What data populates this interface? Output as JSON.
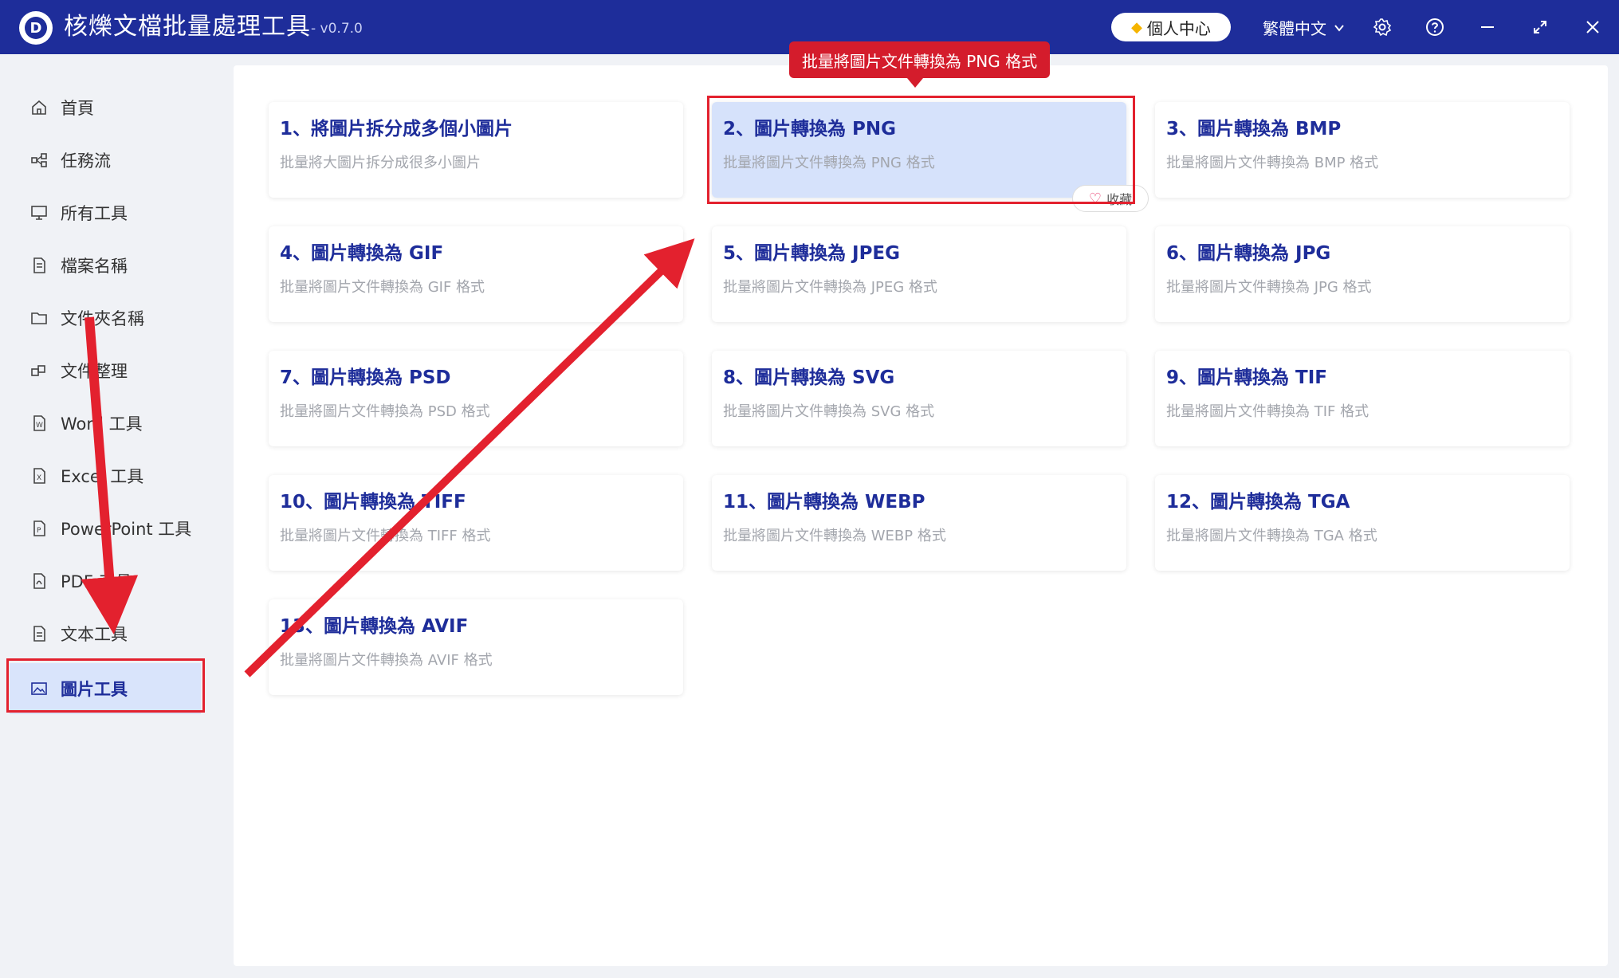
{
  "app": {
    "title": "核爍文檔批量處理工具",
    "version": "- v0.7.0",
    "logo_letter": "D",
    "user_center": "個人中心",
    "language": "繁體中文"
  },
  "sidebar": {
    "items": [
      {
        "label": "首頁",
        "icon": "home-icon"
      },
      {
        "label": "任務流",
        "icon": "workflow-icon"
      },
      {
        "label": "所有工具",
        "icon": "monitor-icon"
      },
      {
        "label": "檔案名稱",
        "icon": "file-icon"
      },
      {
        "label": "文件夾名稱",
        "icon": "folder-icon"
      },
      {
        "label": "文件整理",
        "icon": "organize-icon"
      },
      {
        "label": "Word 工具",
        "icon": "word-icon"
      },
      {
        "label": "Excel 工具",
        "icon": "excel-icon"
      },
      {
        "label": "PowerPoint 工具",
        "icon": "ppt-icon"
      },
      {
        "label": "PDF 工具",
        "icon": "pdf-icon"
      },
      {
        "label": "文本工具",
        "icon": "text-icon"
      },
      {
        "label": "圖片工具",
        "icon": "image-icon",
        "active": true
      }
    ]
  },
  "tools": [
    {
      "title": "1、將圖片拆分成多個小圖片",
      "desc": "批量將大圖片拆分成很多小圖片"
    },
    {
      "title": "2、圖片轉換為 PNG",
      "desc": "批量將圖片文件轉換為 PNG 格式",
      "active": true
    },
    {
      "title": "3、圖片轉換為 BMP",
      "desc": "批量將圖片文件轉換為 BMP 格式"
    },
    {
      "title": "4、圖片轉換為 GIF",
      "desc": "批量將圖片文件轉換為 GIF 格式"
    },
    {
      "title": "5、圖片轉換為 JPEG",
      "desc": "批量將圖片文件轉換為 JPEG 格式"
    },
    {
      "title": "6、圖片轉換為 JPG",
      "desc": "批量將圖片文件轉換為 JPG 格式"
    },
    {
      "title": "7、圖片轉換為 PSD",
      "desc": "批量將圖片文件轉換為 PSD 格式"
    },
    {
      "title": "8、圖片轉換為 SVG",
      "desc": "批量將圖片文件轉換為 SVG 格式"
    },
    {
      "title": "9、圖片轉換為 TIF",
      "desc": "批量將圖片文件轉換為 TIF 格式"
    },
    {
      "title": "10、圖片轉換為 TIFF",
      "desc": "批量將圖片文件轉換為 TIFF 格式"
    },
    {
      "title": "11、圖片轉換為 WEBP",
      "desc": "批量將圖片文件轉換為 WEBP 格式"
    },
    {
      "title": "12、圖片轉換為 TGA",
      "desc": "批量將圖片文件轉換為 TGA 格式"
    },
    {
      "title": "13、圖片轉換為 AVIF",
      "desc": "批量將圖片文件轉換為 AVIF 格式"
    }
  ],
  "favorite_label": "收藏",
  "tooltip": "批量將圖片文件轉換為 PNG 格式",
  "colors": {
    "titlebar": "#1e2d9a",
    "accent": "#1e2d9a",
    "annotation_red": "#e3212e"
  }
}
